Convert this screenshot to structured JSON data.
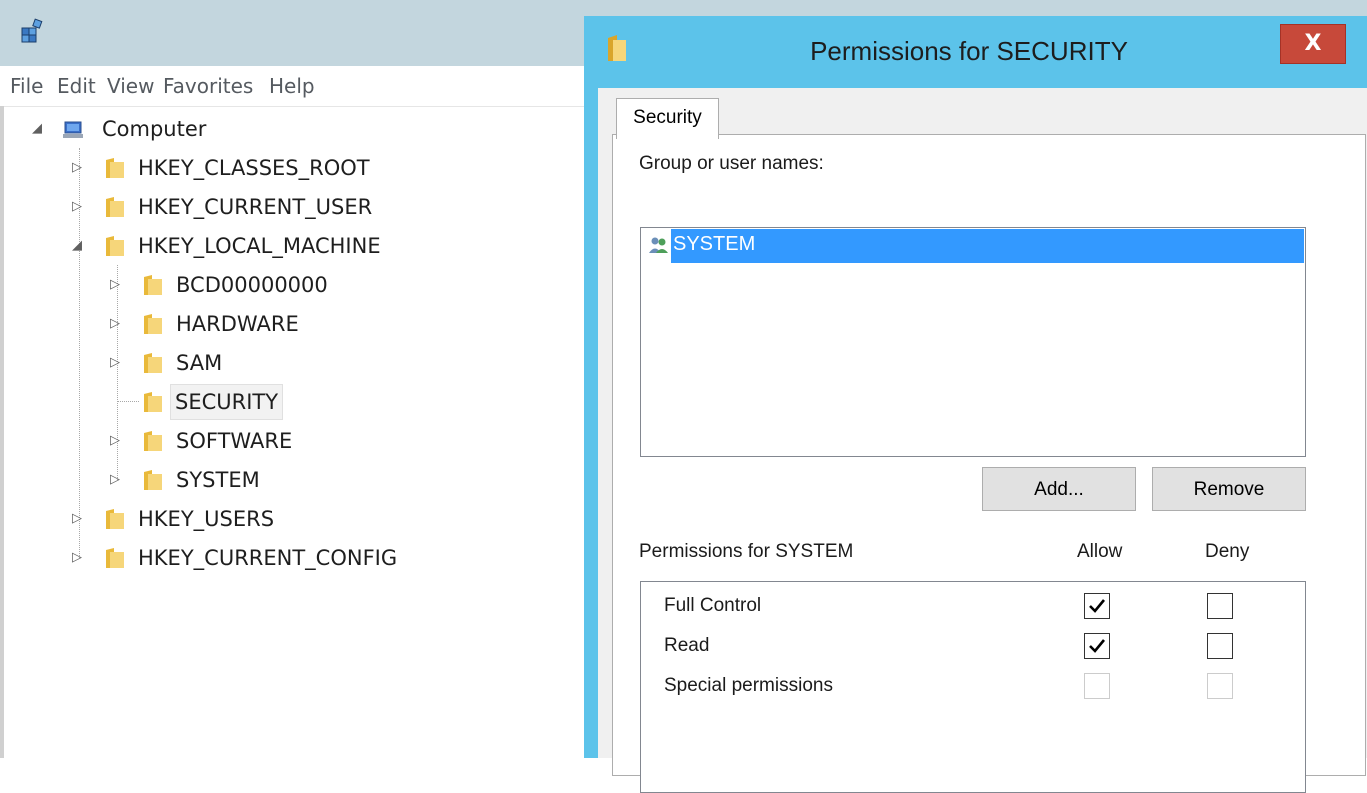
{
  "menu": [
    "File",
    "Edit",
    "View",
    "Favorites",
    "Help"
  ],
  "tree": {
    "root": "Computer",
    "hives": {
      "classes_root": "HKEY_CLASSES_ROOT",
      "current_user": "HKEY_CURRENT_USER",
      "local_machine": "HKEY_LOCAL_MACHINE",
      "users": "HKEY_USERS",
      "current_config": "HKEY_CURRENT_CONFIG"
    },
    "hklm_children": [
      "BCD00000000",
      "HARDWARE",
      "SAM",
      "SECURITY",
      "SOFTWARE",
      "SYSTEM"
    ],
    "selected": "SECURITY"
  },
  "dialog": {
    "title": "Permissions for SECURITY",
    "close_label": "X",
    "tab_label": "Security",
    "group_label": "Group or user names:",
    "users": [
      "SYSTEM"
    ],
    "add_label": "Add...",
    "remove_label": "Remove",
    "permissions_header": "Permissions for SYSTEM",
    "allow_header": "Allow",
    "deny_header": "Deny",
    "permissions": [
      {
        "name": "Full Control",
        "allow": true,
        "deny": false,
        "enabled": true
      },
      {
        "name": "Read",
        "allow": true,
        "deny": false,
        "enabled": true
      },
      {
        "name": "Special permissions",
        "allow": false,
        "deny": false,
        "enabled": false
      }
    ]
  },
  "colors": {
    "dialog_frame": "#5cc3ea",
    "close_button": "#c7493a",
    "selection": "#3399ff"
  }
}
